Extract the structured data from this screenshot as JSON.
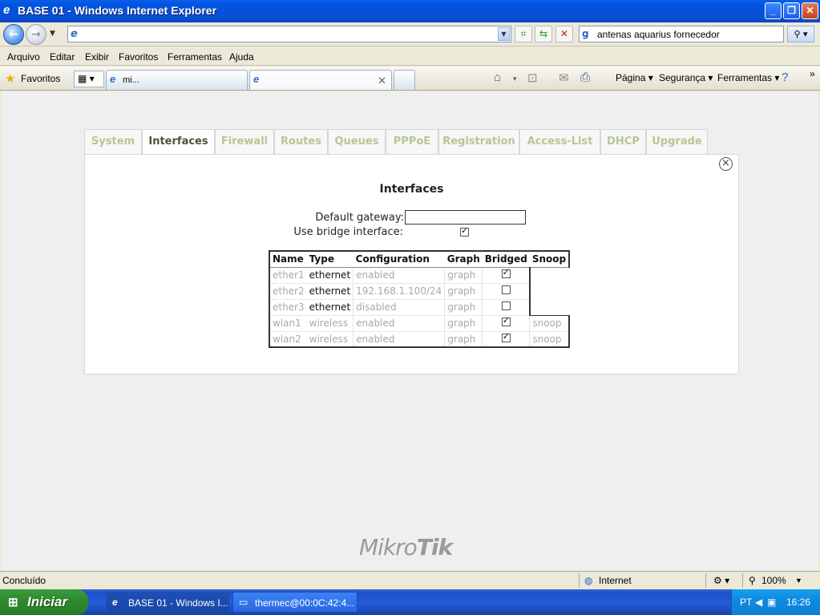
{
  "window": {
    "title": "BASE 01 - Windows Internet Explorer",
    "minimize": "_",
    "restore": "❐",
    "close": "✕"
  },
  "addressbar": {
    "url": "",
    "search_text": "antenas aquarius fornecedor"
  },
  "menu": [
    "Arquivo",
    "Editar",
    "Exibir",
    "Favoritos",
    "Ferramentas",
    "Ajuda"
  ],
  "favbar": {
    "favorites_label": "Favoritos",
    "tab1_label": "mi...",
    "tab2_label": "",
    "commands": {
      "page": "Página ▾",
      "security": "Segurança ▾",
      "tools": "Ferramentas ▾",
      "more": "»"
    }
  },
  "app": {
    "tabs": [
      "System",
      "Interfaces",
      "Firewall",
      "Routes",
      "Queues",
      "PPPoE",
      "Registration",
      "Access-List",
      "DHCP",
      "Upgrade"
    ],
    "active_tab": "Interfaces",
    "panel_title": "Interfaces",
    "default_gateway_label": "Default gateway:",
    "default_gateway_value": "",
    "use_bridge_label": "Use bridge interface:",
    "use_bridge_checked": true,
    "table": {
      "headers": [
        "Name",
        "Type",
        "Configuration",
        "Graph",
        "Bridged",
        "Snoop"
      ],
      "rows": [
        {
          "name": "ether1",
          "type": "ethernet",
          "config": "enabled",
          "graph": "graph",
          "bridged": true,
          "snoop": ""
        },
        {
          "name": "ether2",
          "type": "ethernet",
          "config": "192.168.1.100/24",
          "graph": "graph",
          "bridged": false,
          "snoop": ""
        },
        {
          "name": "ether3",
          "type": "ethernet",
          "config": "disabled",
          "graph": "graph",
          "bridged": false,
          "snoop": ""
        },
        {
          "name": "wlan1",
          "type": "wireless",
          "config": "enabled",
          "graph": "graph",
          "bridged": true,
          "snoop": "snoop"
        },
        {
          "name": "wlan2",
          "type": "wireless",
          "config": "enabled",
          "graph": "graph",
          "bridged": true,
          "snoop": "snoop"
        }
      ]
    },
    "logo_thin": "Mikro",
    "logo_bold": "Tik"
  },
  "statusbar": {
    "status": "Concluído",
    "zone": "Internet",
    "zoom": "100%"
  },
  "taskbar": {
    "start_label": "Iniciar",
    "tasks": [
      "BASE 01 - Windows I...",
      "thermec@00:0C:42:4..."
    ],
    "lang": "PT",
    "clock": "16:26"
  }
}
